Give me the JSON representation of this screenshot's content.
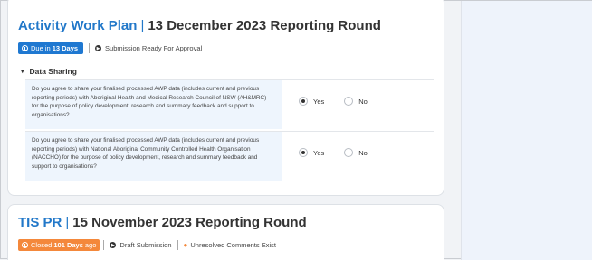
{
  "awp": {
    "title_link": "Activity Work Plan",
    "title_rest": "13 December 2023 Reporting Round",
    "badge_prefix": "Due in",
    "badge_bold": "13 Days",
    "status": "Submission Ready For Approval",
    "section_title": "Data Sharing",
    "questions": [
      {
        "text": "Do you agree to share your finalised processed AWP data (includes current and previous reporting periods) with Aboriginal Health and Medical Research Council of NSW (AH&MRC) for the purpose of policy development, research and summary feedback and support to organisations?",
        "yes": "Yes",
        "no": "No",
        "selected": "Yes"
      },
      {
        "text": "Do you agree to share your finalised processed AWP data (includes current and previous reporting periods) with National Aboriginal Community Controlled Health Organisation (NACCHO) for the purpose of policy development, research and summary feedback and support to organisations?",
        "yes": "Yes",
        "no": "No",
        "selected": "Yes"
      }
    ]
  },
  "tis": {
    "title_link": "TIS PR",
    "title_rest": "15 November 2023 Reporting Round",
    "badge_prefix": "Closed",
    "badge_bold": "101 Days",
    "badge_suffix": "ago",
    "status": "Draft Submission",
    "comments": "Unresolved Comments Exist"
  },
  "colors": {
    "link_blue": "#2278c9",
    "due_badge": "#1f78d1",
    "closed_badge": "#f4883b",
    "question_bg": "#eef5fd"
  },
  "icons": {
    "due": "clock-icon",
    "status": "arrow-circle-icon",
    "comments": "comments-icon",
    "section": "chevron-down-icon"
  }
}
